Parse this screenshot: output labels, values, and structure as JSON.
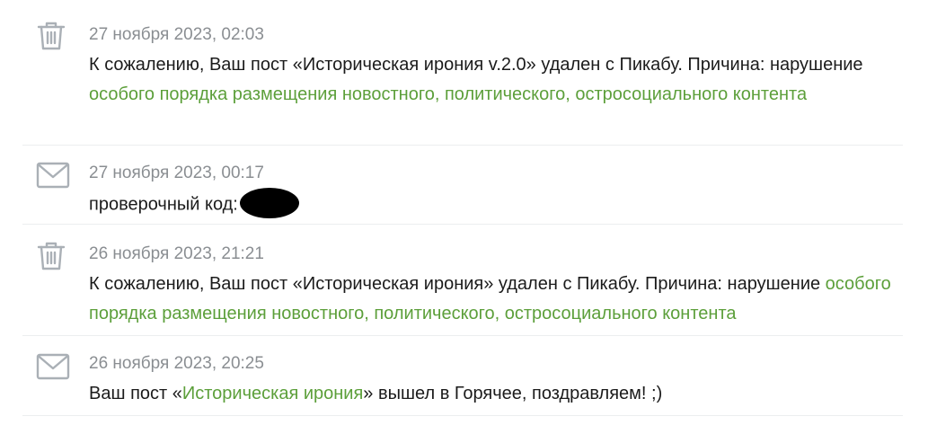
{
  "notifications": [
    {
      "icon": "trash-icon",
      "date": "27 ноября 2023, 02:03",
      "text_pre": "К сожалению, Ваш пост «Историческая ирония v.2.0» удален с Пикабу. Причина: нарушение ",
      "link": "особого порядка размещения новостного, политического, остросоциального контента"
    },
    {
      "icon": "envelope-icon",
      "date": "27 ноября 2023, 00:17",
      "text_pre": "проверочный код:"
    },
    {
      "icon": "trash-icon",
      "date": "26 ноября 2023, 21:21",
      "text_pre": "К сожалению, Ваш пост «Историческая ирония» удален с Пикабу. Причина: нарушение ",
      "link": "особого порядка размещения новостного, политического, остросоциального контента"
    },
    {
      "icon": "envelope-icon",
      "date": "26 ноября 2023, 20:25",
      "text_pre": "Ваш пост «",
      "link": "Историческая ирония",
      "text_post": "» вышел в Горячее, поздравляем! ;)"
    }
  ],
  "colors": {
    "link": "#5c9f3a",
    "date": "#8a8e92",
    "icon": "#aab0b6",
    "divider": "#eceeef"
  }
}
